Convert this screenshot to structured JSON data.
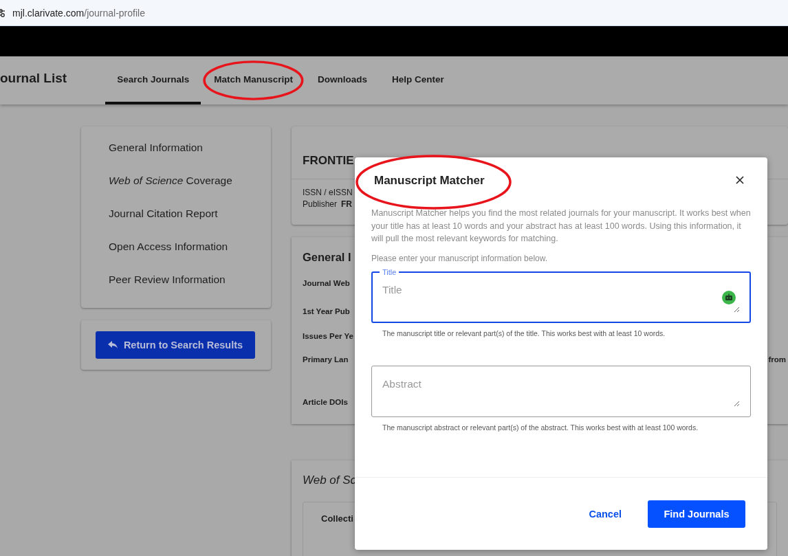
{
  "browser": {
    "url_host": "mjl.clarivate.com",
    "url_path": "/journal-profile"
  },
  "site": {
    "brand": "ournal List",
    "tabs": [
      {
        "label": "Search Journals",
        "selected": true,
        "circled": false
      },
      {
        "label": "Match Manuscript",
        "selected": false,
        "circled": true
      },
      {
        "label": "Downloads",
        "selected": false,
        "circled": false
      },
      {
        "label": "Help Center",
        "selected": false,
        "circled": false
      }
    ]
  },
  "sidebar": {
    "all_items": [
      "General Information",
      "*Web of Science* Coverage",
      "Journal Citation Report",
      "Open Access Information",
      "Peer Review Information"
    ],
    "return_button": "Return to Search Results"
  },
  "journal": {
    "title": "FRONTIE",
    "issn_label": "ISSN / eISSN",
    "publisher_label": "Publisher",
    "publisher_value": "FR",
    "general_heading": "General I",
    "fields": [
      {
        "label": "Journal Web"
      },
      {
        "label": "1st Year Pub"
      },
      {
        "label": "Issues Per Ye"
      },
      {
        "label": "Primary Lan",
        "value": "from"
      },
      {
        "label": "Article DOIs"
      }
    ],
    "coverage_heading": "Web of Sc",
    "coverage_column": "Collecti"
  },
  "modal": {
    "title": "Manuscript Matcher",
    "title_circled": true,
    "description": "Manuscript Matcher helps you find the most related journals for your manuscript. It works best when your title has at least 10 words and your abstract has at least 100 words. Using this information, it will pull the most relevant keywords for matching.",
    "prompt": "Please enter your manuscript information below.",
    "fields": [
      {
        "label": "Title",
        "placeholder": "Title",
        "focused": true,
        "hint": "The manuscript title or relevant part(s) of the title. This works best with at least 10 words."
      },
      {
        "placeholder": "Abstract",
        "focused": false,
        "hint": "The manuscript abstract or relevant part(s) of the abstract. This works best with at least 100 words."
      }
    ],
    "buttons": [
      {
        "label": "Cancel",
        "kind": "link"
      },
      {
        "label": "Find Journals",
        "kind": "primary"
      }
    ]
  }
}
